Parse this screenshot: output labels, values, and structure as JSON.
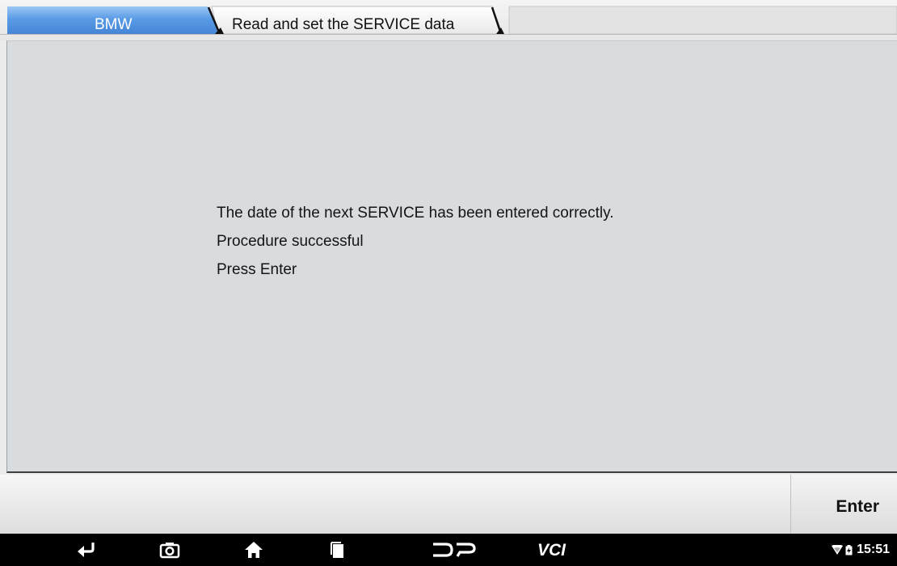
{
  "breadcrumb": {
    "root": "BMW",
    "page": "Read and set the SERVICE data"
  },
  "message": {
    "lines": [
      "The date of the next SERVICE has been entered correctly.",
      "Procedure successful",
      "Press Enter"
    ]
  },
  "actions": {
    "enter_label": "Enter"
  },
  "navbar": {
    "icons": [
      "back-icon",
      "screenshot-icon",
      "home-icon",
      "recent-apps-icon",
      "dp-icon",
      "vci-icon"
    ],
    "vci_label": "VCI",
    "dp_label": "DP"
  },
  "status": {
    "time": "15:51",
    "icons": [
      "wifi-icon",
      "battery-icon"
    ]
  },
  "colors": {
    "tab_active": "#5a9be5",
    "panel_bg": "#d9dcdf",
    "navbar_bg": "#000000"
  }
}
